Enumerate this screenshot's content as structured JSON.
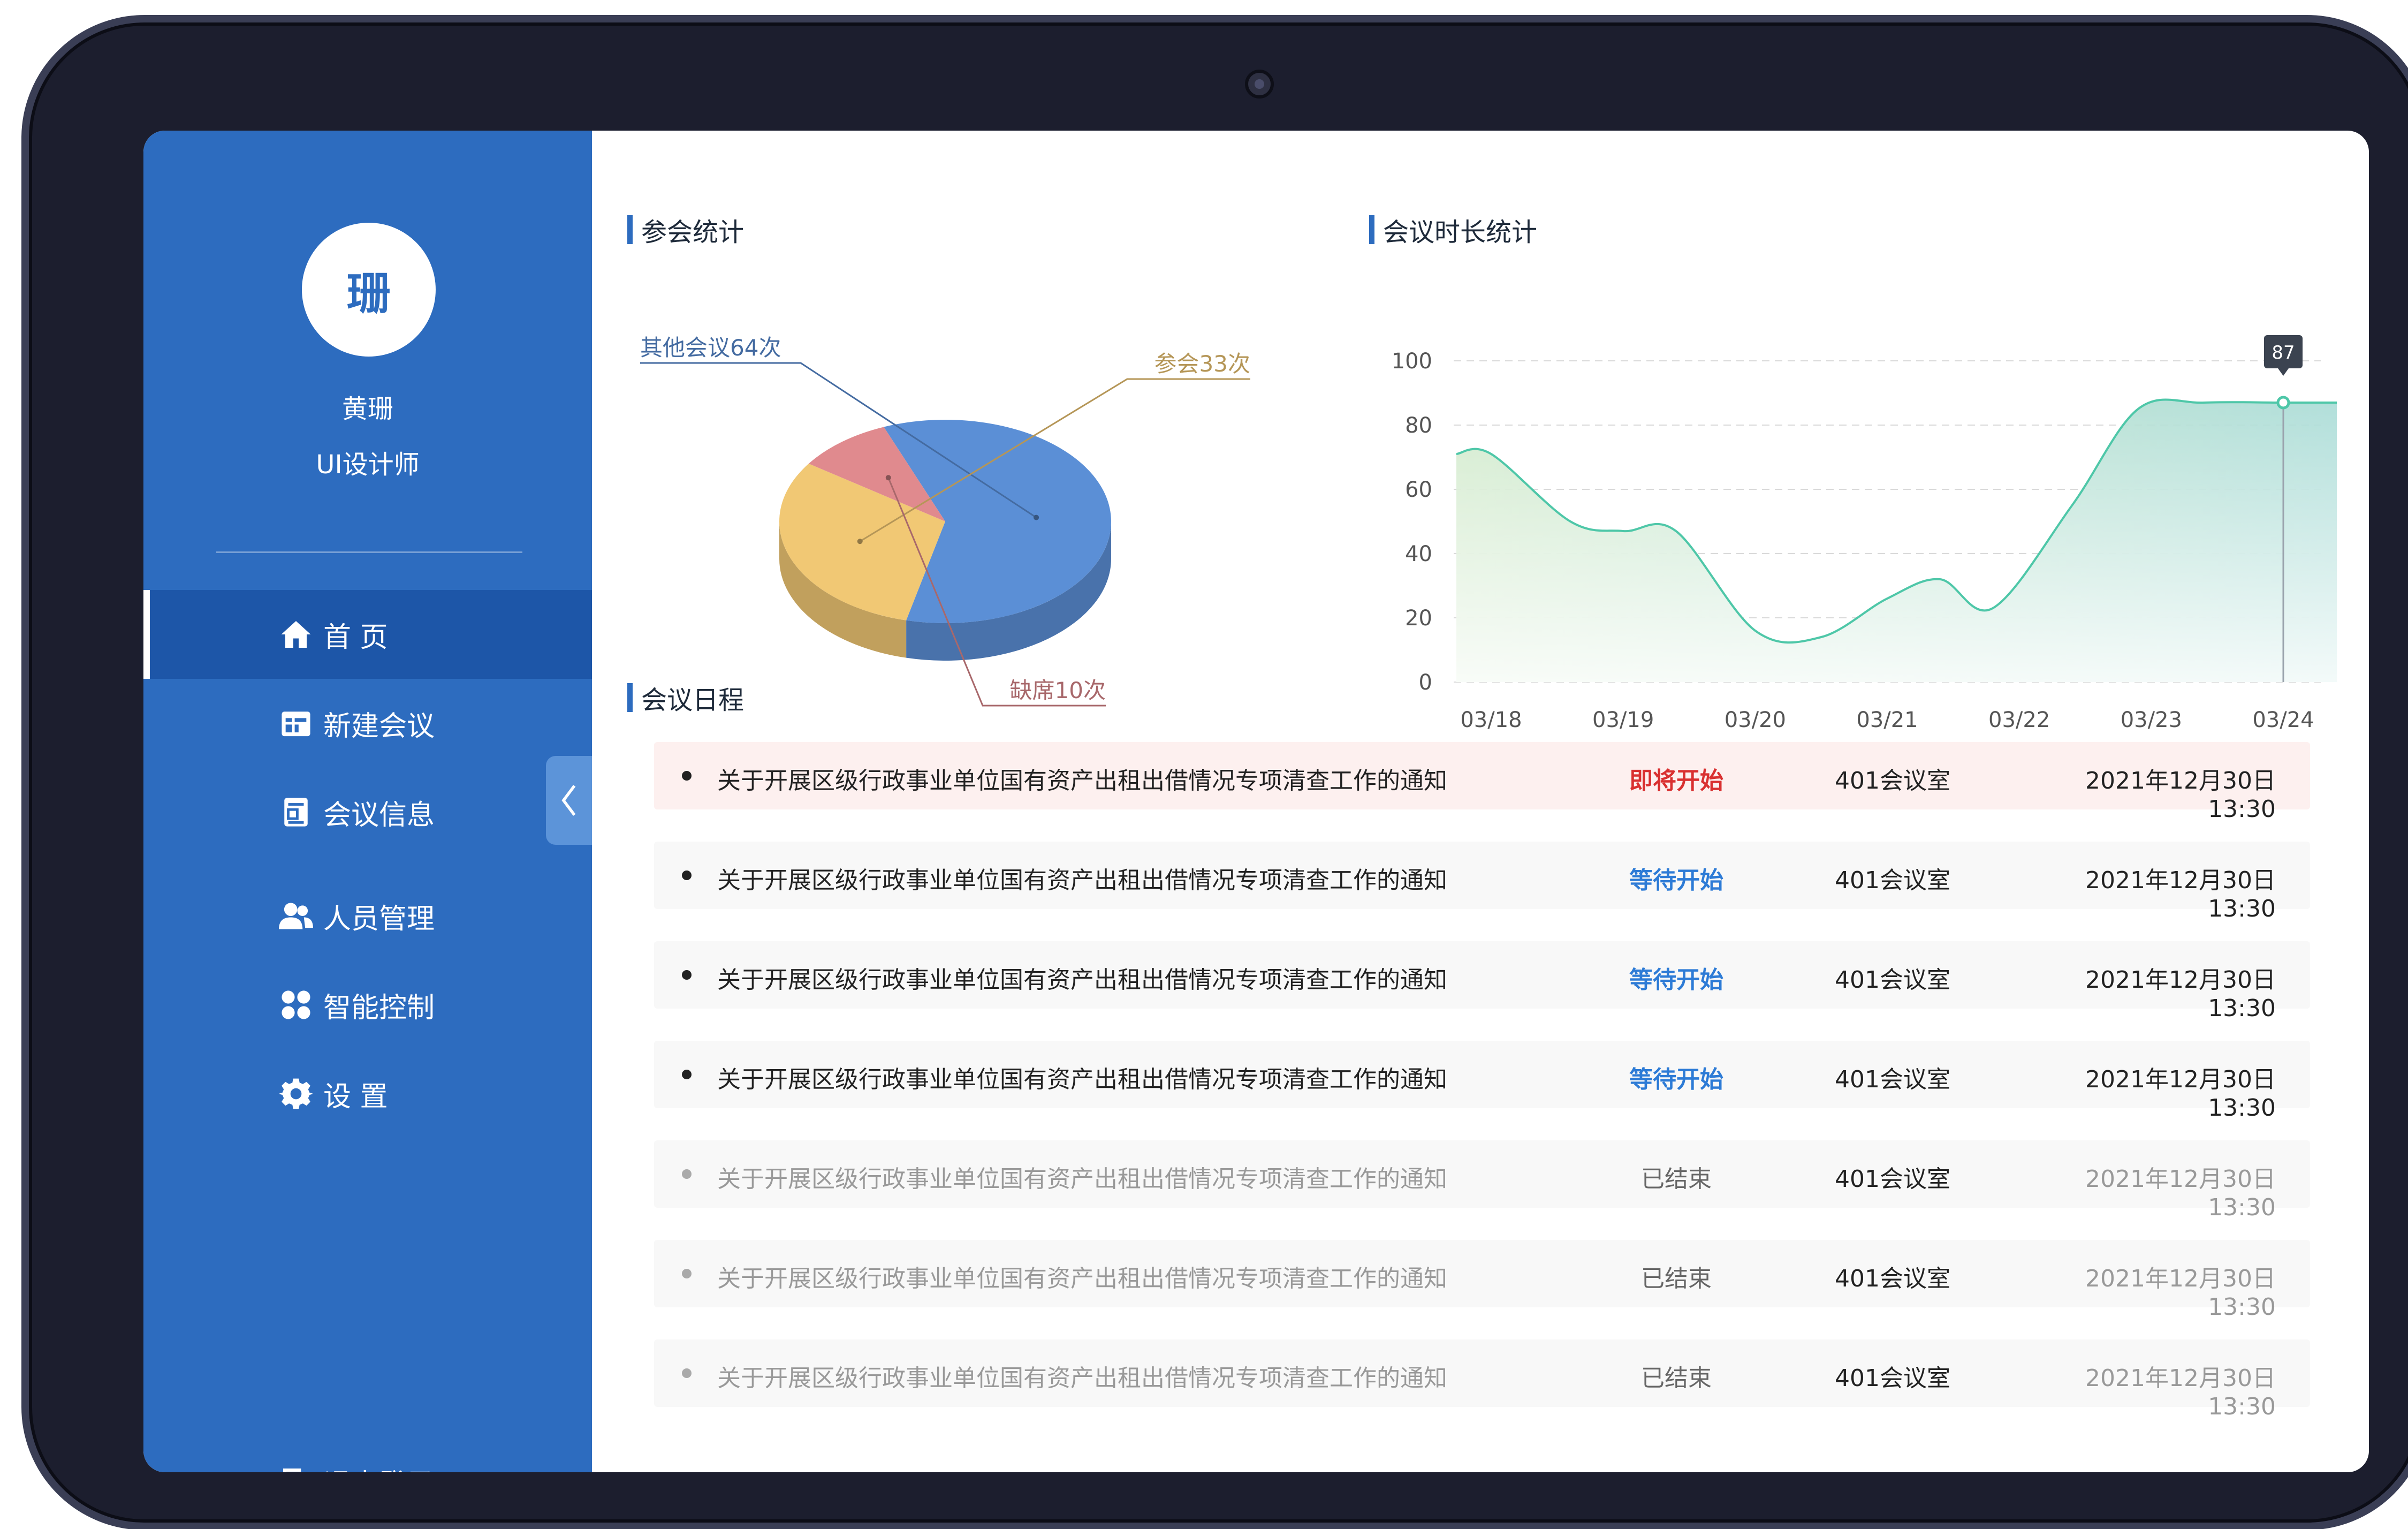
{
  "user": {
    "avatar_char": "珊",
    "name": "黄珊",
    "role": "UI设计师"
  },
  "nav": [
    {
      "label": "首  页",
      "icon": "home-icon",
      "active": true
    },
    {
      "label": "新建会议",
      "icon": "new-meeting-icon",
      "active": false
    },
    {
      "label": "会议信息",
      "icon": "meeting-info-icon",
      "active": false
    },
    {
      "label": "人员管理",
      "icon": "people-icon",
      "active": false
    },
    {
      "label": "智能控制",
      "icon": "smart-control-icon",
      "active": false
    },
    {
      "label": "设  置",
      "icon": "gear-icon",
      "active": false
    }
  ],
  "logout_label": "退出登录",
  "sections": {
    "attendance": "参会统计",
    "duration": "会议时长统计",
    "schedule": "会议日程"
  },
  "chart_data": [
    {
      "type": "pie",
      "title": "参会统计",
      "slices": [
        {
          "label": "其他会议64次",
          "value": 64,
          "color": "#5b8fd6"
        },
        {
          "label": "参会33次",
          "value": 33,
          "color": "#f1c874"
        },
        {
          "label": "缺席10次",
          "value": 10,
          "color": "#e08a8e"
        }
      ]
    },
    {
      "type": "area",
      "title": "会议时长统计",
      "categories": [
        "03/18",
        "03/19",
        "03/20",
        "03/21",
        "03/22",
        "03/23",
        "03/24"
      ],
      "x": [
        0,
        0.6,
        1.0,
        1.4,
        2.0,
        2.5,
        3.0,
        3.4,
        3.8,
        4.4,
        4.9,
        5.4,
        6.0,
        6.5
      ],
      "y": [
        71,
        50,
        47,
        47,
        16,
        14,
        26,
        32,
        23,
        55,
        85,
        87,
        87,
        87
      ],
      "yticks": [
        0,
        20,
        40,
        60,
        80,
        100
      ],
      "ylim": [
        0,
        100
      ],
      "highlight": {
        "label": "87",
        "value": 87
      },
      "color": "#4ec7a8"
    }
  ],
  "schedule": [
    {
      "title": "关于开展区级行政事业单位国有资产出租出借情况专项清查工作的通知",
      "status": "即将开始",
      "status_color": "#d93030",
      "room": "401会议室",
      "time": "2021年12月30日  13:30",
      "state": "upcoming"
    },
    {
      "title": "关于开展区级行政事业单位国有资产出租出借情况专项清查工作的通知",
      "status": "等待开始",
      "status_color": "#2d7bd6",
      "room": "401会议室",
      "time": "2021年12月30日  13:30",
      "state": "waiting"
    },
    {
      "title": "关于开展区级行政事业单位国有资产出租出借情况专项清查工作的通知",
      "status": "等待开始",
      "status_color": "#2d7bd6",
      "room": "401会议室",
      "time": "2021年12月30日  13:30",
      "state": "waiting"
    },
    {
      "title": "关于开展区级行政事业单位国有资产出租出借情况专项清查工作的通知",
      "status": "等待开始",
      "status_color": "#2d7bd6",
      "room": "401会议室",
      "time": "2021年12月30日  13:30",
      "state": "waiting"
    },
    {
      "title": "关于开展区级行政事业单位国有资产出租出借情况专项清查工作的通知",
      "status": "已结束",
      "status_color": "#666666",
      "room": "401会议室",
      "time": "2021年12月30日  13:30",
      "state": "ended"
    },
    {
      "title": "关于开展区级行政事业单位国有资产出租出借情况专项清查工作的通知",
      "status": "已结束",
      "status_color": "#666666",
      "room": "401会议室",
      "time": "2021年12月30日  13:30",
      "state": "ended"
    },
    {
      "title": "关于开展区级行政事业单位国有资产出租出借情况专项清查工作的通知",
      "status": "已结束",
      "status_color": "#666666",
      "room": "401会议室",
      "time": "2021年12月30日  13:30",
      "state": "ended"
    }
  ]
}
